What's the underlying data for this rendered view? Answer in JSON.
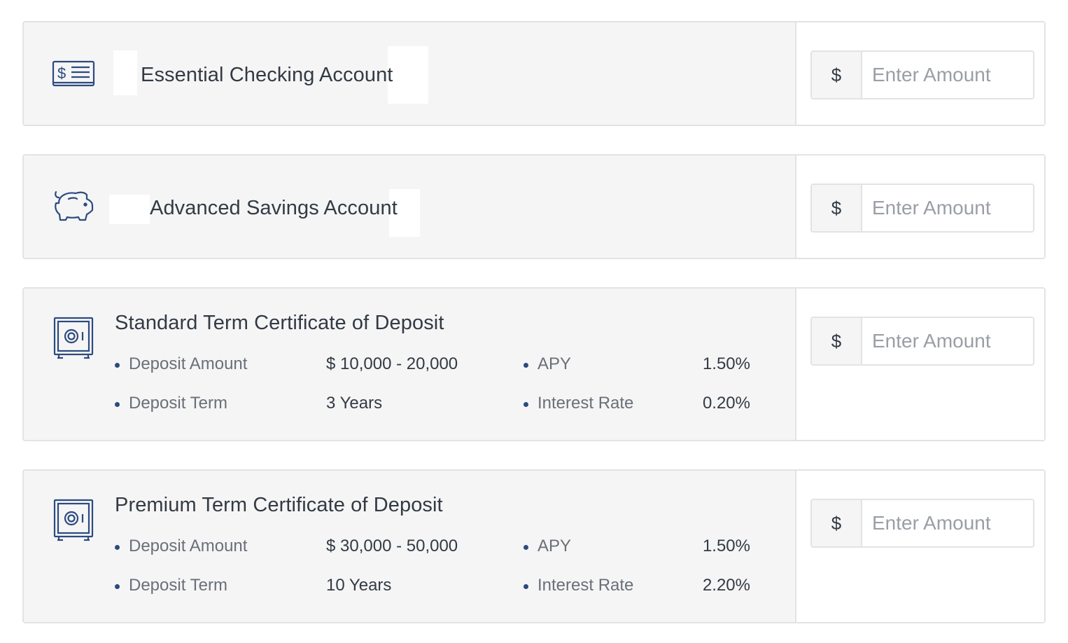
{
  "accounts": [
    {
      "title": "Essential Checking Account",
      "icon": "check-icon",
      "amount": {
        "currency": "$",
        "placeholder": "Enter Amount",
        "value": ""
      }
    },
    {
      "title": "Advanced Savings Account",
      "icon": "piggy-bank-icon",
      "amount": {
        "currency": "$",
        "placeholder": "Enter Amount",
        "value": ""
      }
    },
    {
      "title": "Standard Term Certificate of Deposit",
      "icon": "safe-icon",
      "details": {
        "deposit_amount_label": "Deposit Amount",
        "deposit_amount_value": "$ 10,000 - 20,000",
        "apy_label": "APY",
        "apy_value": "1.50%",
        "deposit_term_label": "Deposit Term",
        "deposit_term_value": "3 Years",
        "interest_rate_label": "Interest Rate",
        "interest_rate_value": "0.20%"
      },
      "amount": {
        "currency": "$",
        "placeholder": "Enter Amount",
        "value": ""
      }
    },
    {
      "title": "Premium Term Certificate of Deposit",
      "icon": "safe-icon",
      "details": {
        "deposit_amount_label": "Deposit Amount",
        "deposit_amount_value": "$ 30,000 - 50,000",
        "apy_label": "APY",
        "apy_value": "1.50%",
        "deposit_term_label": "Deposit Term",
        "deposit_term_value": "10 Years",
        "interest_rate_label": "Interest Rate",
        "interest_rate_value": "2.20%"
      },
      "amount": {
        "currency": "$",
        "placeholder": "Enter Amount",
        "value": ""
      }
    }
  ],
  "colors": {
    "accent": "#2c4a80",
    "card_bg": "#f5f5f5",
    "border": "#e3e3e3",
    "text": "#333a44",
    "label": "#6a6f78",
    "placeholder": "#9a9ea5"
  }
}
